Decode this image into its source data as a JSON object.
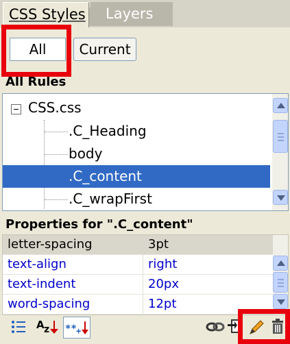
{
  "tabs": [
    {
      "label": "CSS Styles",
      "active": true
    },
    {
      "label": "Layers",
      "active": false
    }
  ],
  "mode_toggle": {
    "all_label": "All",
    "current_label": "Current",
    "selected": "All"
  },
  "rules_panel": {
    "header": "All Rules",
    "items": [
      {
        "label": "CSS.css",
        "level": 0,
        "expanded": true,
        "selected": false
      },
      {
        "label": ".C_Heading",
        "level": 1,
        "selected": false
      },
      {
        "label": "body",
        "level": 1,
        "selected": false
      },
      {
        "label": ".C_content",
        "level": 1,
        "selected": true
      },
      {
        "label": ".C_wrapFirst",
        "level": 1,
        "selected": false
      }
    ]
  },
  "properties_panel": {
    "header": "Properties for \".C_content\"",
    "rows": [
      {
        "name": "letter-spacing",
        "value": "3pt"
      },
      {
        "name": "text-align",
        "value": "right"
      },
      {
        "name": "text-indent",
        "value": "20px"
      },
      {
        "name": "word-spacing",
        "value": "12pt"
      }
    ]
  },
  "toolbar": {
    "left_icons": [
      "category-view-icon",
      "alphabetical-view-icon",
      "set-properties-view-icon"
    ],
    "right_icons": [
      "attach-stylesheet-icon",
      "new-css-rule-icon",
      "edit-style-icon",
      "delete-css-rule-icon"
    ]
  },
  "colors": {
    "selection": "#316ac5",
    "highlight_box": "#e8000c",
    "property_text_blue": "#0000cc",
    "panel_bg": "#ece9d8"
  }
}
